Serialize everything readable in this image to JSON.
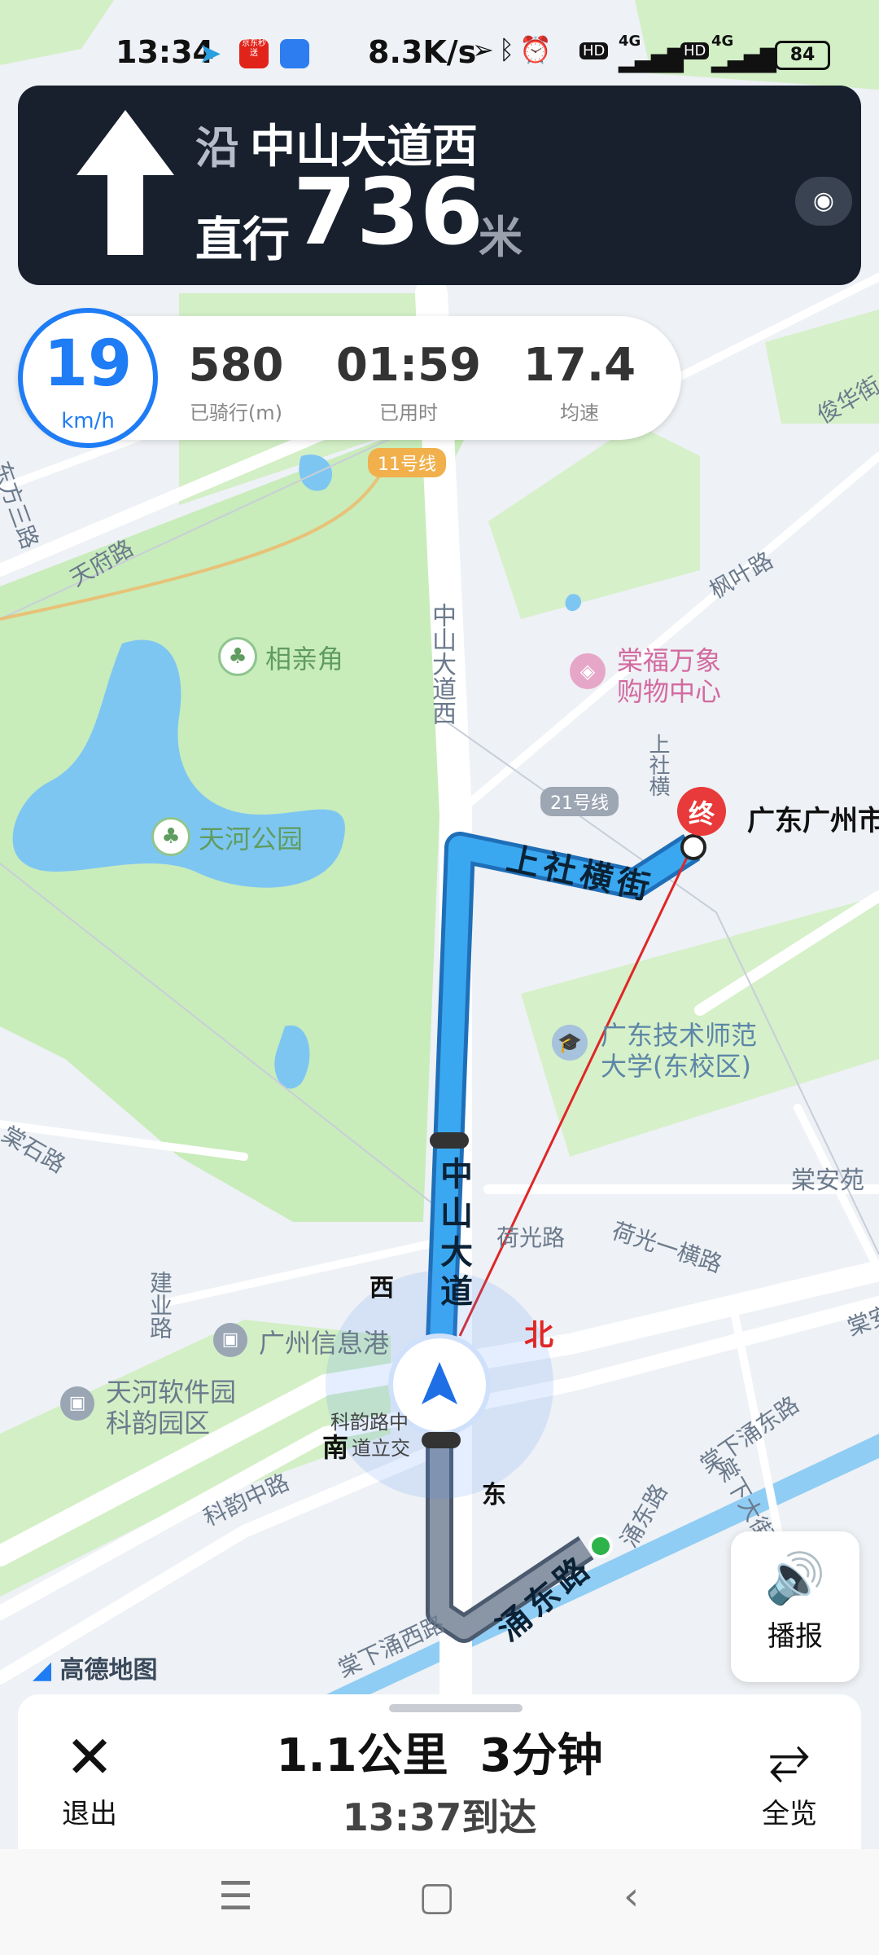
{
  "status_bar": {
    "time": "13:34",
    "net_speed": "8.3K/s",
    "battery": "84",
    "sig1": "4G",
    "sig2": "4G",
    "hd1": "HD",
    "hd2": "HD",
    "app_badge": "京东秒送"
  },
  "nav": {
    "along": "沿",
    "road": "中山大道西",
    "action": "直行",
    "distance": "736",
    "unit": "米"
  },
  "stats": {
    "speed": "19",
    "speed_unit": "km/h",
    "ridden": "580",
    "ridden_label": "已骑行(m)",
    "elapsed": "01:59",
    "elapsed_label": "已用时",
    "avg": "17.4",
    "avg_label": "均速"
  },
  "map": {
    "roads": {
      "dongfang3": "东方三路",
      "tianfu": "天府路",
      "zhongshan_w": "中山大道西",
      "shangshe_heng": "上社横街",
      "shangshe_heng2": "上社横",
      "fengye": "枫叶路",
      "junhua": "俊华街",
      "zhongshan_dao": "中山大道",
      "heguang": "荷光路",
      "heguang1": "荷光一横路",
      "tangshi": "棠石路",
      "jianye": "建业路",
      "keyun_zhong": "科韵中路",
      "yongdong": "涌东路",
      "yongdong2": "涌东路",
      "tangxia_yongxi": "棠下涌西路",
      "tangxia_yongdong": "棠下涌东路",
      "tangxia_dajie": "棠下大街",
      "tangan": "棠安"
    },
    "pois": {
      "xiangqinjiao": "相亲角",
      "tianhe_park": "天河公园",
      "tangfu_1": "棠福万象",
      "tangfu_2": "购物中心",
      "gdtnu_1": "广东技术师范",
      "gdtnu_2": "大学(东校区)",
      "tanganyuan": "棠安苑",
      "gz_info_port": "广州信息港",
      "tianhe_soft_1": "天河软件园",
      "tianhe_soft_2": "科韵园区",
      "keyun_interchange_1": "科韵路中",
      "keyun_interchange_2": "道立交",
      "dest_city": "广东广州市"
    },
    "metro": {
      "line11": "11号线",
      "line21": "21号线"
    },
    "compass": {
      "north": "北",
      "south": "南",
      "east": "东",
      "west": "西"
    },
    "dest_marker": "终",
    "brand": "高德地图"
  },
  "bottom": {
    "exit": "退出",
    "overview": "全览",
    "remaining_dist": "1.1公里",
    "remaining_time": "3分钟",
    "arrival": "13:37到达",
    "voice": "播报"
  },
  "colors": {
    "route_active": "#3aa8f0",
    "route_passed": "#8a96a6",
    "accent": "#1e7cf5",
    "nav_bg": "#18202e",
    "park": "#c8eab8",
    "water": "#7ec6f2"
  }
}
